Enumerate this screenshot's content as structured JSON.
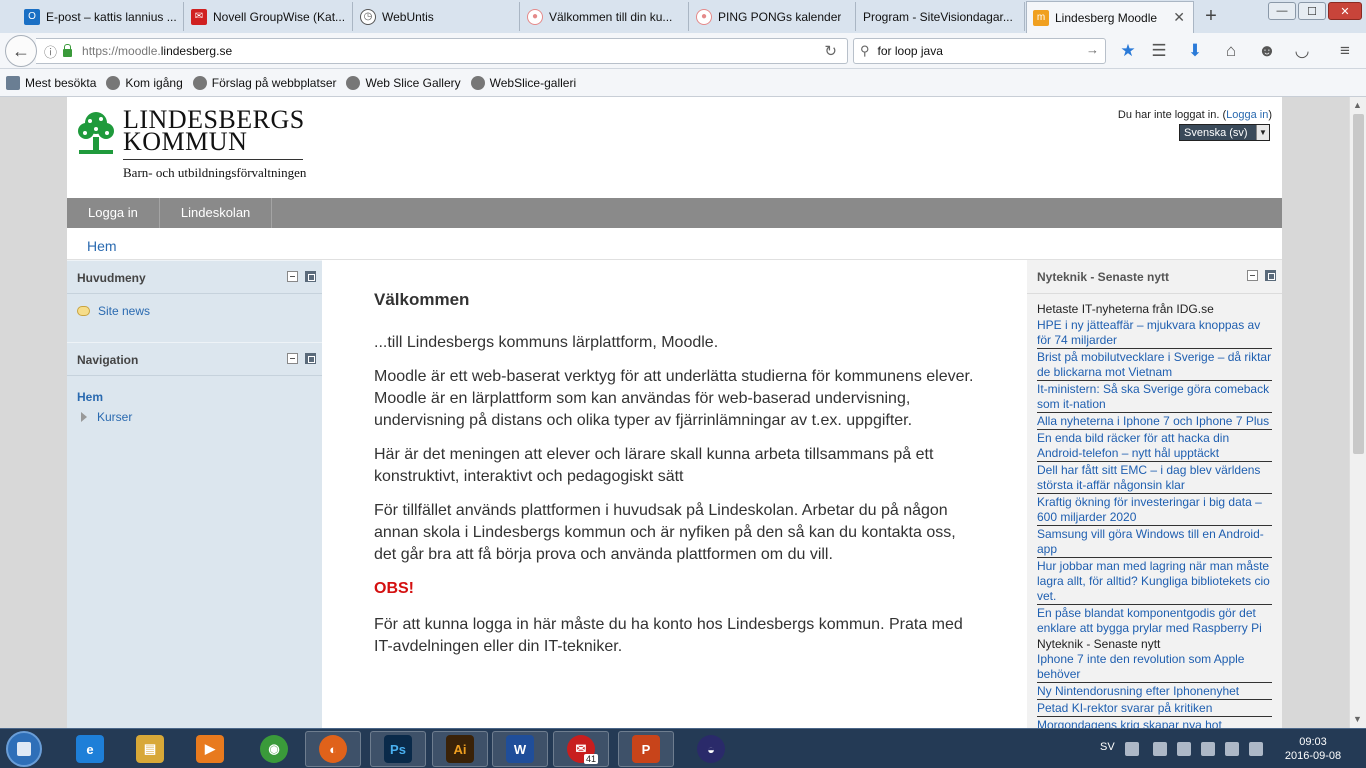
{
  "browser": {
    "tabs": [
      {
        "label": "E-post – kattis lannius ...",
        "icon_color": "#1a6fc4",
        "icon_char": "O"
      },
      {
        "label": "Novell GroupWise (Kat...",
        "icon_color": "#d02020",
        "icon_char": "✉"
      },
      {
        "label": "WebUntis",
        "icon_color": "#555555",
        "icon_char": "◷"
      },
      {
        "label": "Välkommen till din ku...",
        "icon_color": "#e58a8a",
        "icon_char": "●"
      },
      {
        "label": "PING PONGs kalender",
        "icon_color": "#e58a8a",
        "icon_char": "●"
      },
      {
        "label": "Program - SiteVisiondagar...",
        "icon_color": "#d9e3ee",
        "icon_char": ""
      },
      {
        "label": "Lindesberg Moodle",
        "icon_color": "#e8a020",
        "icon_char": "m"
      }
    ],
    "new_tab": "+",
    "window_controls": {
      "minimize": "—",
      "maximize": "☐",
      "close": "✕"
    },
    "url_prefix": "https://moodle.",
    "url_domain": "lindesberg.se",
    "search_query": "for loop java",
    "bookmarks": [
      "Mest besökta",
      "Kom igång",
      "Förslag på webbplatser",
      "Web Slice Gallery",
      "WebSlice-galleri"
    ]
  },
  "header": {
    "logo_line1": "LINDESBERGS",
    "logo_line2": "KOMMUN",
    "logo_sub": "Barn- och utbildningsförvaltningen",
    "login_text": "Du har inte loggat in. (",
    "login_link": "Logga in",
    "login_close": ")",
    "language": "Svenska (sv)"
  },
  "menu": [
    "Logga in",
    "Lindeskolan"
  ],
  "breadcrumb": "Hem",
  "left": {
    "main_menu_title": "Huvudmeny",
    "site_news": "Site news",
    "navigation_title": "Navigation",
    "nav_home": "Hem",
    "nav_courses": "Kurser"
  },
  "content": {
    "heading": "Välkommen",
    "p1": "...till Lindesbergs kommuns lärplattform, Moodle.",
    "p2": "Moodle är ett web-baserat verktyg för att underlätta studierna för kommunens elever. Moodle är en lärplattform som kan användas för web-baserad undervisning, undervisning på distans och olika typer av fjärrinlämningar av t.ex. uppgifter.",
    "p3": "Här är det meningen att elever och lärare skall kunna arbeta tillsammans på ett konstruktivt, interaktivt och pedagogiskt sätt",
    "p4": "För tillfället används plattformen i huvudsak på Lindeskolan. Arbetar du på någon annan skola i Lindesbergs kommun och är nyfiken på den så kan du kontakta oss, det går bra att få börja prova och använda plattformen om du vill.",
    "obs": "OBS!",
    "p5": "För att kunna logga in här måste du ha konto hos Lindesbergs kommun. Prata med IT-avdelningen eller din IT-tekniker."
  },
  "right": {
    "title": "Nyteknik - Senaste nytt",
    "feed1_head": "Hetaste IT-nyheterna från IDG.se",
    "feed1": [
      "HPE i ny jätteaffär – mjukvara knoppas av för 74 miljarder",
      "Brist på mobilutvecklare i Sverige – då riktar de blickarna mot Vietnam",
      "It-ministern: Så ska Sverige göra comeback som it-nation",
      "Alla nyheterna i Iphone 7 och Iphone 7 Plus",
      "En enda bild räcker för att hacka din Android-telefon – nytt hål upptäckt",
      "Dell har fått sitt EMC – i dag blev världens största it-affär någonsin klar",
      "Kraftig ökning för investeringar i big data – 600 miljarder 2020",
      "Samsung vill göra Windows till en Android-app",
      "Hur jobbar man med lagring när man måste lagra allt, för alltid? Kungliga bibliotekets cio vet.",
      "En påse blandat komponentgodis gör det enklare att bygga prylar med Raspberry Pi"
    ],
    "feed2_head": "Nyteknik - Senaste nytt",
    "feed2": [
      "Iphone 7 inte den revolution som Apple behöver",
      "Ny Nintendorusning efter Iphonenyhet",
      "Petad KI-rektor svarar på kritiken",
      "Morgondagens krig skapar nya hot"
    ]
  },
  "taskbar": {
    "apps": [
      {
        "name": "ie",
        "label": "e",
        "color": "#1e7fd8"
      },
      {
        "name": "explorer",
        "label": "▤",
        "color": "#d8a838"
      },
      {
        "name": "media-player",
        "label": "▶",
        "color": "#e87a1e"
      },
      {
        "name": "chrome",
        "label": "◉",
        "color": "#3a9a3a"
      },
      {
        "name": "firefox",
        "label": "◐",
        "color": "#e0621a"
      },
      {
        "name": "photoshop",
        "label": "Ps",
        "color": "#0a2a4a"
      },
      {
        "name": "illustrator",
        "label": "Ai",
        "color": "#3a2208"
      },
      {
        "name": "word",
        "label": "W",
        "color": "#1f4e9a"
      },
      {
        "name": "groupwise",
        "label": "✉",
        "color": "#c81e1e"
      },
      {
        "name": "powerpoint",
        "label": "P",
        "color": "#c8441a"
      },
      {
        "name": "eclipse",
        "label": "◒",
        "color": "#2a2a6a"
      }
    ],
    "mail_badge": "41",
    "tray_lang": "SV",
    "time": "09:03",
    "date": "2016-09-08"
  }
}
